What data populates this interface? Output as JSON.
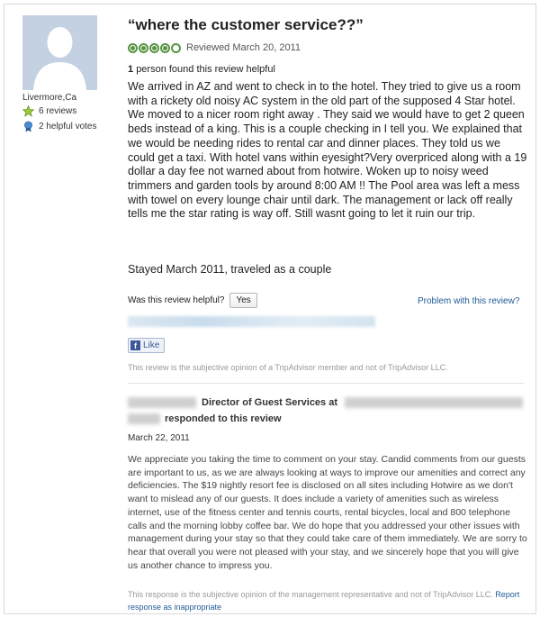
{
  "reviewer": {
    "location": "Livermore,Ca",
    "reviews": "6 reviews",
    "helpful_votes": "2 helpful votes"
  },
  "review": {
    "title": "“where the customer service??”",
    "rating": 4,
    "rating_max": 5,
    "reviewed_date": "Reviewed March 20, 2011",
    "helpful_count": "1",
    "helpful_text": "person found this review helpful",
    "body": "We arrived in AZ and went to check in to the hotel. They tried to give us a room with a rickety old noisy AC system in the old part of the supposed 4 Star hotel. We moved to a nicer room right away . They said we would have to get 2 queen beds instead of a king. This is a couple checking in I tell you. We explained that we would be needing rides to rental car and dinner places. They told us we could get a taxi. With hotel vans within eyesight?Very overpriced along with a 19 dollar a day fee not warned about from hotwire. Woken up to noisy weed trimmers and garden tools by around 8:00 AM !! The Pool area was left a mess with towel on every lounge chair until dark. The management or lack off really tells me the star rating is way off. Still wasnt going to let it ruin our trip.",
    "stayed": "Stayed March 2011, traveled as a couple",
    "was_helpful_label": "Was this review helpful?",
    "yes_label": "Yes",
    "problem_label": "Problem with this review?",
    "like_label": "Like",
    "disclaimer": "This review is the subjective opinion of a TripAdvisor member and not of TripAdvisor LLC."
  },
  "response": {
    "role": "Director of Guest Services at",
    "responded": "responded to this review",
    "date": "March 22, 2011",
    "body": "We appreciate you taking the time to comment on your stay. Candid comments from our guests are important to us, as we are always looking at ways to improve our amenities and correct any deficiencies. The $19 nightly resort fee is disclosed on all sites including Hotwire as we don't want to mislead any of our guests. It does include a variety of amenities such as wireless internet, use of the fitness center and tennis courts, rental bicycles, local and 800 telephone calls and the morning lobby coffee bar. We do hope that you addressed your other issues with management during your stay so that they could take care of them immediately. We are sorry to hear that overall you were not pleased with your stay, and we sincerely hope that you will give us another chance to impress you.",
    "disclaimer": "This response is the subjective opinion of the management representative and not of TripAdvisor LLC.",
    "report_label": "Report response as inappropriate"
  },
  "colors": {
    "bubble": "#589442",
    "link": "#1f5a96",
    "facebook": "#3b5998"
  }
}
